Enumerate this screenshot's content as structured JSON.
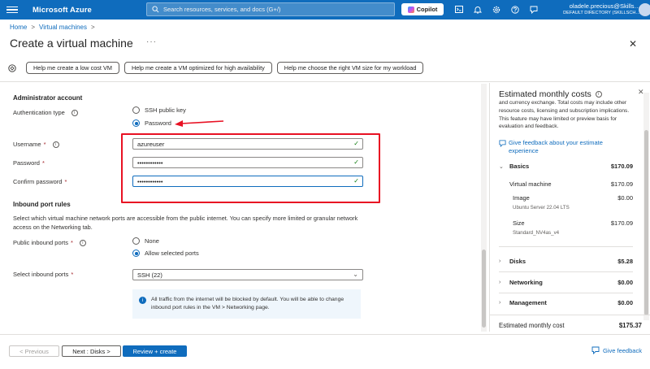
{
  "topbar": {
    "brand": "Microsoft Azure",
    "search_placeholder": "Search resources, services, and docs (G+/)",
    "copilot_label": "Copilot",
    "icons": [
      "cloud-shell-icon",
      "bell-icon",
      "gear-icon",
      "help-icon",
      "feedback-icon"
    ],
    "account_user": "oladele.precious@Skills…",
    "account_directory": "DEFAULT DIRECTORY (SKILLSCH…"
  },
  "breadcrumb": {
    "home": "Home",
    "sep": ">",
    "vms": "Virtual machines"
  },
  "page": {
    "title": "Create a virtual machine",
    "more": "···",
    "close": "✕"
  },
  "helpers": {
    "low_cost": "Help me create a low cost VM",
    "high_avail": "Help me create a VM optimized for high availability",
    "vm_size": "Help me choose the right VM size for my workload"
  },
  "admin": {
    "heading": "Administrator account",
    "auth_label": "Authentication type",
    "auth_options": [
      "SSH public key",
      "Password"
    ],
    "auth_selected": "Password",
    "username_label": "Username",
    "username_value": "azureuser",
    "password_label": "Password",
    "password_value": "••••••••••••",
    "confirm_label": "Confirm password",
    "confirm_value": "••••••••••••",
    "required_mark": "*",
    "check": "✓"
  },
  "inbound": {
    "heading": "Inbound port rules",
    "description": "Select which virtual machine network ports are accessible from the public internet. You can specify more limited or granular network access on the Networking tab.",
    "public_label": "Public inbound ports",
    "public_options": [
      "None",
      "Allow selected ports"
    ],
    "public_selected": "Allow selected ports",
    "select_label": "Select inbound ports",
    "select_value": "SSH (22)",
    "info_text": "All traffic from the internet will be blocked by default. You will be able to change inbound port rules in the VM > Networking page."
  },
  "footer": {
    "previous": "< Previous",
    "next": "Next : Disks >",
    "review": "Review + create",
    "feedback": "Give feedback"
  },
  "costs": {
    "title": "Estimated monthly costs",
    "intro": "and currency exchange. Total costs may include other resource costs, licensing and subscription implications. This feature may have limited or preview basis for evaluation and feedback.",
    "feedback_link": "Give feedback about your estimate experience",
    "basics_label": "Basics",
    "basics_value": "$170.09",
    "vm_label": "Virtual machine",
    "vm_value": "$170.09",
    "image_label": "Image",
    "image_value": "$0.00",
    "image_sub": "Ubuntu Server 22.04 LTS",
    "size_label": "Size",
    "size_value": "$170.09",
    "size_sub": "Standard_NV4as_v4",
    "disks_label": "Disks",
    "disks_value": "$5.28",
    "networking_label": "Networking",
    "networking_value": "$0.00",
    "management_label": "Management",
    "management_value": "$0.00",
    "total_label": "Estimated monthly cost",
    "total_value": "$175.37"
  },
  "colors": {
    "accent": "#0f6cbd",
    "annotation": "#e81123",
    "valid": "#107c10"
  }
}
